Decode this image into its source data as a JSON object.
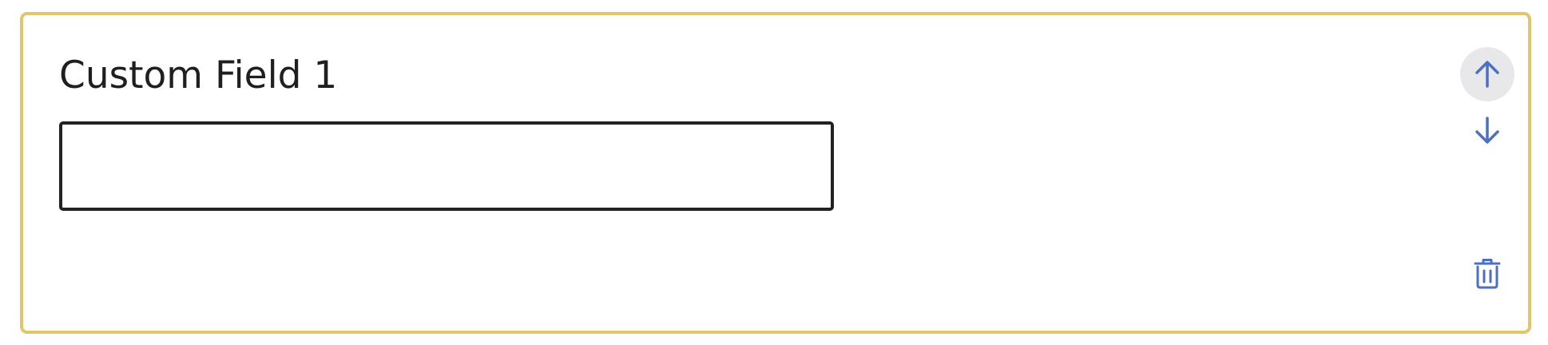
{
  "custom_field": {
    "label": "Custom Field 1",
    "value": "",
    "placeholder": ""
  },
  "actions": {
    "move_up_icon": "arrow-up-icon",
    "move_down_icon": "arrow-down-icon",
    "delete_icon": "trash-icon"
  },
  "colors": {
    "card_border": "#e3c56a",
    "icon": "#4f6fbf",
    "input_border": "#222222",
    "text": "#1f1f1f",
    "up_button_bg": "#e8e8eb"
  }
}
